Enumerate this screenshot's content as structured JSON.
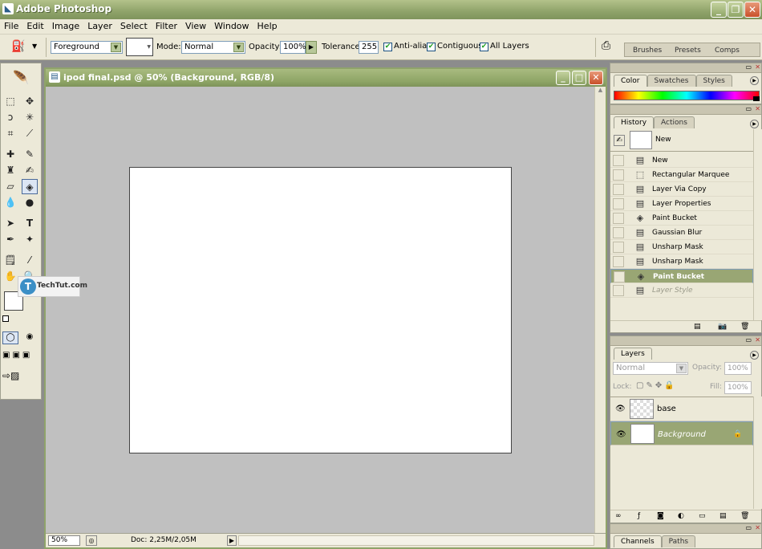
{
  "app": {
    "title": "Adobe Photoshop"
  },
  "menu": [
    "File",
    "Edit",
    "Image",
    "Layer",
    "Select",
    "Filter",
    "View",
    "Window",
    "Help"
  ],
  "options": {
    "fill_source": "Foreground",
    "mode_label": "Mode:",
    "mode_value": "Normal",
    "opacity_label": "Opacity:",
    "opacity_value": "100%",
    "tolerance_label": "Tolerance:",
    "tolerance_value": "255",
    "antialias_label": "Anti-alias",
    "contiguous_label": "Contiguous",
    "all_layers_label": "All Layers",
    "checks": {
      "antialias": true,
      "contiguous": true,
      "all_layers": true
    }
  },
  "well_tabs": [
    "Brushes",
    "Presets",
    "Comps"
  ],
  "document": {
    "title": "ipod final.psd @ 50% (Background, RGB/8)",
    "zoom": "50%",
    "doc_size": "Doc: 2,25M/2,05M"
  },
  "watermark": {
    "text": "TechTut.com"
  },
  "color_panel": {
    "tabs": [
      "Color",
      "Swatches",
      "Styles"
    ]
  },
  "history_panel": {
    "tabs": [
      "History",
      "Actions"
    ],
    "snapshot": "New",
    "items": [
      {
        "label": "New",
        "icon": "doc-icon",
        "state": "normal"
      },
      {
        "label": "Rectangular Marquee",
        "icon": "marquee-icon",
        "state": "normal"
      },
      {
        "label": "Layer Via Copy",
        "icon": "doc-icon",
        "state": "normal"
      },
      {
        "label": "Layer Properties",
        "icon": "doc-icon",
        "state": "normal"
      },
      {
        "label": "Paint Bucket",
        "icon": "bucket-icon",
        "state": "normal"
      },
      {
        "label": "Gaussian Blur",
        "icon": "doc-icon",
        "state": "normal"
      },
      {
        "label": "Unsharp Mask",
        "icon": "doc-icon",
        "state": "normal"
      },
      {
        "label": "Unsharp Mask",
        "icon": "doc-icon",
        "state": "normal"
      },
      {
        "label": "Paint Bucket",
        "icon": "bucket-icon",
        "state": "selected"
      },
      {
        "label": "Layer Style",
        "icon": "doc-icon",
        "state": "dimmed"
      }
    ]
  },
  "layers_panel": {
    "tab": "Layers",
    "blend_mode": "Normal",
    "opacity_label": "Opacity:",
    "opacity_value": "100%",
    "lock_label": "Lock:",
    "fill_label": "Fill:",
    "fill_value": "100%",
    "layers": [
      {
        "name": "base",
        "selected": false,
        "transparent": true
      },
      {
        "name": "Background",
        "selected": true,
        "transparent": false
      }
    ]
  },
  "channels_panel": {
    "tabs": [
      "Channels",
      "Paths"
    ]
  },
  "colors": {
    "title_green": "#8fa36a",
    "selection_green": "#99a674",
    "panel_bg": "#ece9d8"
  }
}
